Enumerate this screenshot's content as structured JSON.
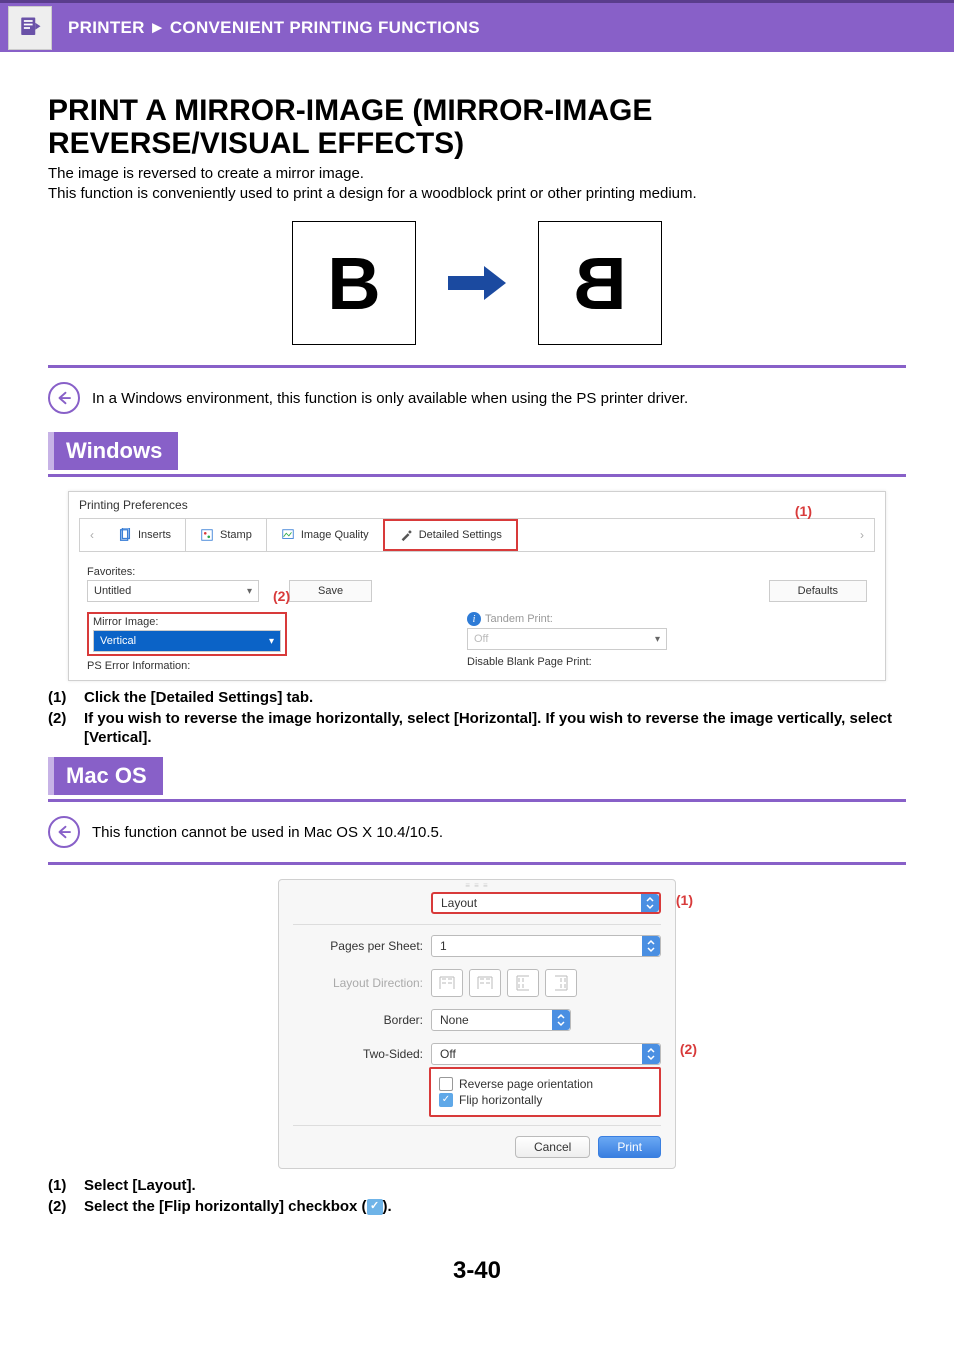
{
  "breadcrumb": {
    "section": "PRINTER",
    "page": "CONVENIENT PRINTING FUNCTIONS"
  },
  "title": "PRINT A MIRROR-IMAGE (MIRROR-IMAGE REVERSE/VISUAL EFFECTS)",
  "description_line1": "The image is reversed to create a mirror image.",
  "description_line2": "This function is conveniently used to print a design for a woodblock print or other printing medium.",
  "illustration": {
    "left_letter": "B",
    "right_letter": "B"
  },
  "note_windows_only": "In a Windows environment, this function is only available when using the PS printer driver.",
  "windows_tag": "Windows",
  "macos_tag": "Mac OS",
  "windows_screenshot": {
    "window_title": "Printing Preferences",
    "tabs": {
      "inserts": "Inserts",
      "stamp": "Stamp",
      "image_quality": "Image Quality",
      "detailed_settings": "Detailed Settings"
    },
    "callout1": "(1)",
    "callout2": "(2)",
    "favorites_label": "Favorites:",
    "favorites_value": "Untitled",
    "save_btn": "Save",
    "defaults_btn": "Defaults",
    "mirror_label": "Mirror Image:",
    "mirror_value": "Vertical",
    "ps_error_label": "PS Error Information:",
    "tandem_label": "Tandem Print:",
    "tandem_value": "Off",
    "disable_blank_label": "Disable Blank Page Print:"
  },
  "windows_steps": {
    "s1": "Click the [Detailed Settings] tab.",
    "s2": "If you wish to reverse the image horizontally, select [Horizontal]. If you wish to reverse the image vertically, select [Vertical]."
  },
  "note_macos": "This function cannot be used in Mac OS X 10.4/10.5.",
  "mac_screenshot": {
    "callout1": "(1)",
    "callout2": "(2)",
    "panel_select": "Layout",
    "pages_per_sheet_label": "Pages per Sheet:",
    "pages_per_sheet_value": "1",
    "layout_direction_label": "Layout Direction:",
    "border_label": "Border:",
    "border_value": "None",
    "two_sided_label": "Two-Sided:",
    "two_sided_value": "Off",
    "reverse_orientation": "Reverse page orientation",
    "flip_horizontally": "Flip horizontally",
    "cancel": "Cancel",
    "print": "Print"
  },
  "mac_steps": {
    "s1": "Select [Layout].",
    "s2_a": "Select the [Flip horizontally] checkbox (",
    "s2_b": ")."
  },
  "page_number": "3-40"
}
